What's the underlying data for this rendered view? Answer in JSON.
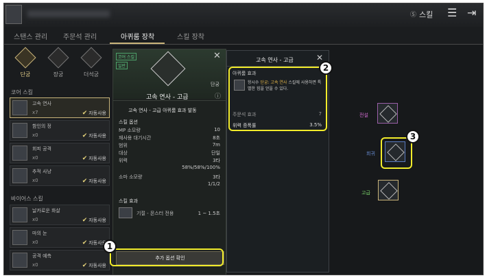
{
  "topbar": {
    "skill_label": "스킬",
    "skill_icon": "skill-icon"
  },
  "tabs": [
    {
      "label": "스탠스 관리"
    },
    {
      "label": "주문석 관리"
    },
    {
      "label": "아퀴룸 장착"
    },
    {
      "label": "스킬 장착"
    }
  ],
  "categories": [
    {
      "label": "단궁"
    },
    {
      "label": "장궁"
    },
    {
      "label": "더석궁"
    }
  ],
  "left": {
    "core_title": "코어 스킬",
    "bias_title": "바이어스 스킬",
    "core_rows": [
      {
        "name": "고속 연사",
        "count": "x7",
        "auto": "자동사용"
      },
      {
        "name": "함인의 정",
        "count": "x0",
        "auto": "자동사용"
      },
      {
        "name": "회피 공격",
        "count": "x0",
        "auto": "자동사용"
      },
      {
        "name": "추적 사냥",
        "count": "x0",
        "auto": "자동사용"
      }
    ],
    "bias_rows": [
      {
        "name": "날카로운 화살",
        "count": "x0",
        "auto": "자동사용"
      },
      {
        "name": "마의 눈",
        "count": "x0",
        "auto": "자동사용"
      },
      {
        "name": "공격 예측",
        "count": "x0",
        "auto": "자동사용"
      }
    ]
  },
  "middle": {
    "badge_core": "코어 스킬",
    "badge_tier": "일반",
    "weapon": "단궁",
    "skill_name": "고속 연사 - 고급",
    "effect_title": "고속 연사 - 고급 아퀴룸 효과 발동",
    "options_title": "스킬 옵션",
    "options": [
      {
        "label": "MP 소모량",
        "value": "10"
      },
      {
        "label": "재사용 대기시간",
        "value": "8초"
      },
      {
        "label": "범위",
        "value": "7m"
      },
      {
        "label": "대상",
        "value": "단일"
      },
      {
        "label": "위력",
        "value": "3타"
      },
      {
        "label": "",
        "value": "58%/58%/100%"
      },
      {
        "label": "소마 소모량",
        "value": "3타"
      },
      {
        "label": "",
        "value": "1/1/2"
      }
    ],
    "effect_section": "스킬 효과",
    "effect_name": "기절 - 몬스터 전용",
    "effect_value": "1 ~ 1.5초",
    "confirm_button": "추가 옵션 확인"
  },
  "right_panel": {
    "title": "고속 연사 - 고급",
    "aquirum_title": "아퀴룸 효과",
    "aquirum_text_1": "항시수",
    "aquirum_text_highlight": "단궁: 고속 연사",
    "aquirum_text_2": "스킬에",
    "aquirum_text_3": "사용하면 특별한 힘을 얻을 수 있다.",
    "order_title": "주문석 효과",
    "order_value": "7",
    "power_label": "위력 증폭률",
    "power_value": "3.5%"
  },
  "tiers": [
    {
      "label": "전설",
      "color": "#d46cd4"
    },
    {
      "label": "희귀",
      "color": "#6a8fd8"
    },
    {
      "label": "고급",
      "color": "#7ad46a"
    }
  ],
  "badges": [
    "1",
    "2",
    "3"
  ]
}
